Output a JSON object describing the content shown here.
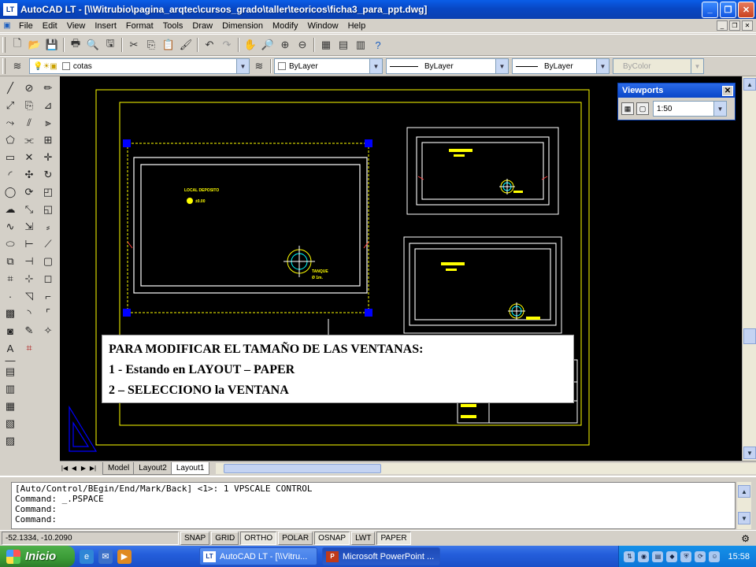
{
  "window": {
    "app_icon_label": "LT",
    "title": "AutoCAD LT - [\\\\Witrubio\\pagina_arqtec\\cursos_grado\\taller\\teoricos\\ficha3_para_ppt.dwg]",
    "minimize_glyph": "_",
    "maximize_glyph": "❐",
    "close_glyph": "✕"
  },
  "menu": {
    "items": [
      "File",
      "Edit",
      "View",
      "Insert",
      "Format",
      "Tools",
      "Draw",
      "Dimension",
      "Modify",
      "Window",
      "Help"
    ],
    "doc_min": "_",
    "doc_restore": "❐",
    "doc_close": "✕"
  },
  "layer_bar": {
    "layer_name": "cotas",
    "color": "ByLayer",
    "linetype": "ByLayer",
    "lineweight": "ByLayer",
    "plotstyle": "ByColor"
  },
  "viewports_toolbar": {
    "title": "Viewports",
    "close_glyph": "✕",
    "scale": "1:50"
  },
  "drawing": {
    "plan1_label": "LOCAL DEPOSITO",
    "plan1_level": "±0.00",
    "tank_label": "TANQUE",
    "tank_size": "Ø 1m."
  },
  "callout": {
    "line1": "PARA MODIFICAR EL TAMAÑO DE LAS VENTANAS:",
    "line2": "1 - Estando en LAYOUT – PAPER",
    "line3": "2 – SELECCIONO la VENTANA"
  },
  "tabs": {
    "nav": [
      "|◀",
      "◀",
      "▶",
      "▶|"
    ],
    "items": [
      "Model",
      "Layout2",
      "Layout1"
    ],
    "active": "Layout1"
  },
  "command": {
    "lines": [
      "[Auto/Control/BEgin/End/Mark/Back] <1>: 1 VPSCALE CONTROL",
      "Command: _.PSPACE",
      "Command:",
      "Command:"
    ]
  },
  "status": {
    "coords": "-52.1334, -10.2090",
    "buttons": [
      "SNAP",
      "GRID",
      "ORTHO",
      "POLAR",
      "OSNAP",
      "LWT",
      "PAPER"
    ]
  },
  "taskbar": {
    "start_label": "Inicio",
    "tasks": [
      {
        "label": "AutoCAD LT - [\\\\Vitru...",
        "icon": "LT"
      },
      {
        "label": "Microsoft PowerPoint ...",
        "icon": "P"
      }
    ],
    "clock": "15:58"
  },
  "colors": {
    "paper_border": "#ffff00",
    "grip": "#0000ff",
    "tank_symbol": "#00ffff",
    "model_background": "#000000"
  }
}
